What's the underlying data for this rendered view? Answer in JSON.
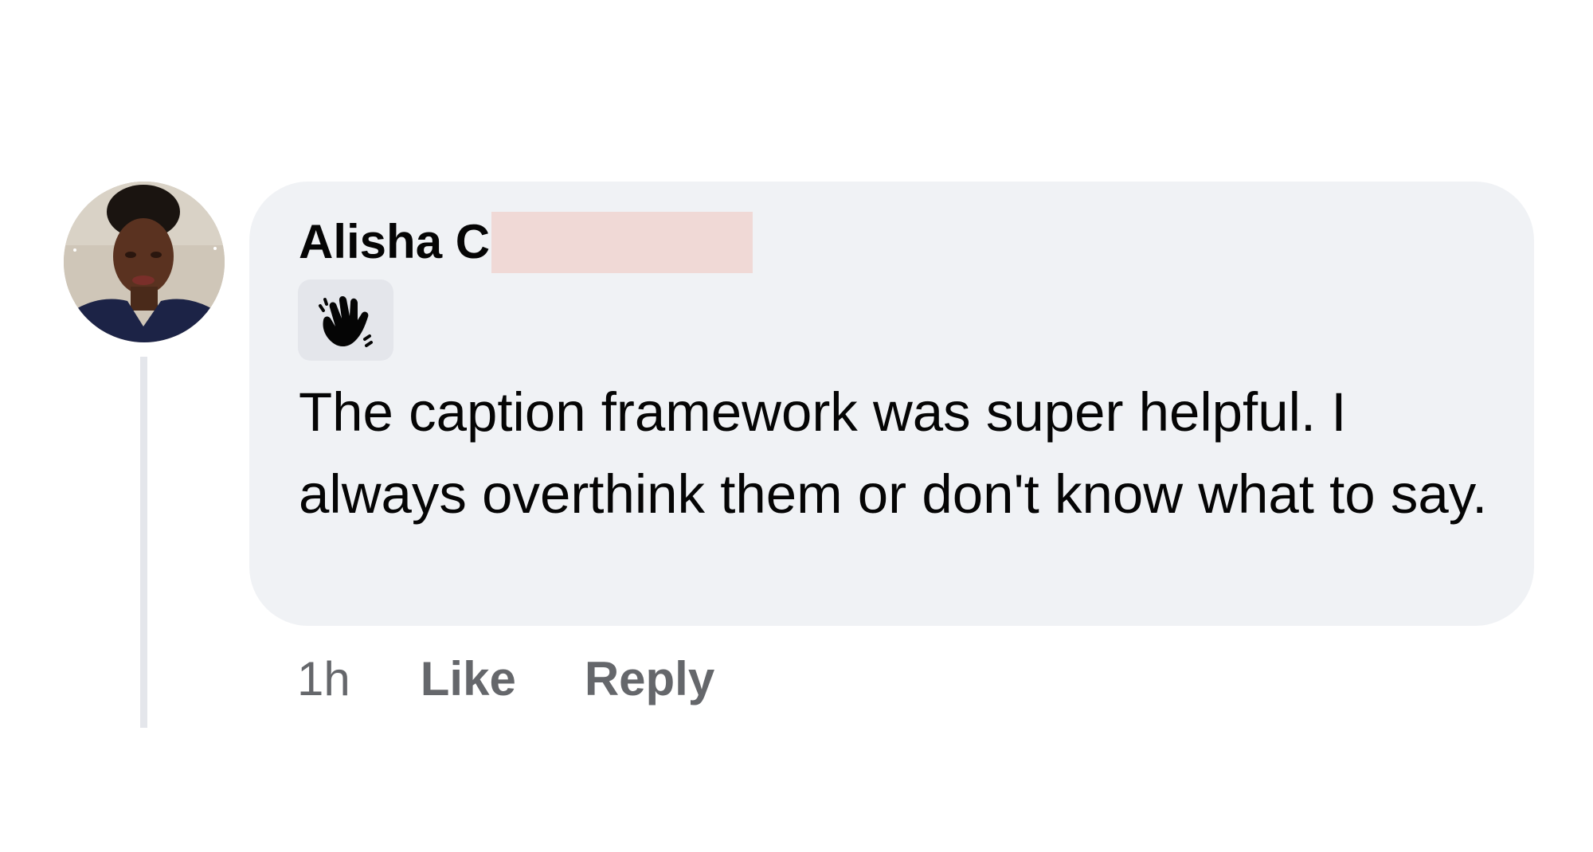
{
  "comment": {
    "author": "Alisha C",
    "badge_icon": "waving-hand-icon",
    "text": "The caption framework was super helpful. I always overthink them or don't know what to say.",
    "timestamp": "1h",
    "actions": {
      "like_label": "Like",
      "reply_label": "Reply"
    }
  },
  "colors": {
    "bubble_background": "#f0f2f5",
    "text_primary": "#050505",
    "text_secondary": "#65676b",
    "redaction": "#f0d9d6",
    "thread_line": "#e4e6eb"
  }
}
